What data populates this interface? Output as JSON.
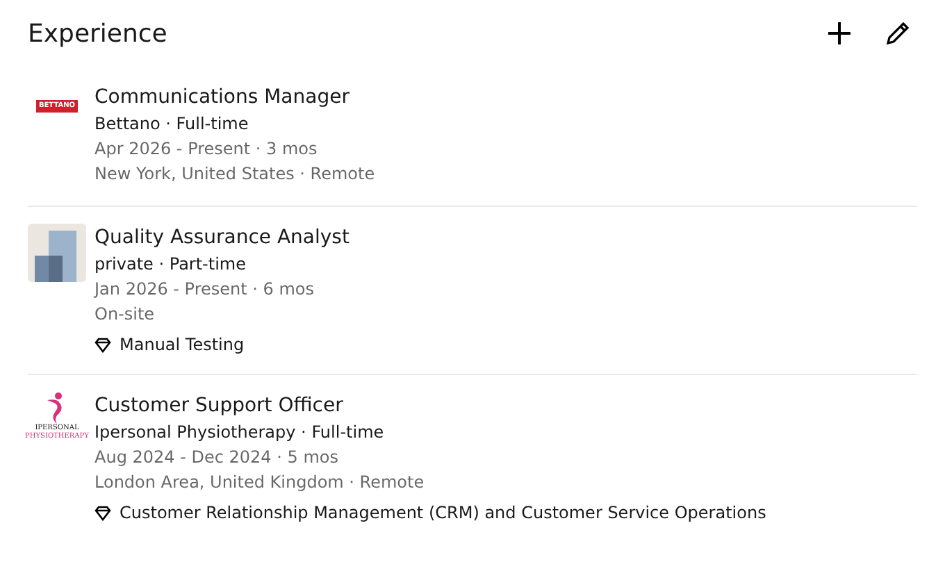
{
  "section": {
    "title": "Experience"
  },
  "experiences": [
    {
      "logo": {
        "kind": "wordmark",
        "text": "BETTANO"
      },
      "title": "Communications Manager",
      "company": "Bettano · Full-time",
      "dates": "Apr 2026 - Present · 3 mos",
      "location": "New York, United States · Remote"
    },
    {
      "logo": {
        "kind": "blocks"
      },
      "title": "Quality Assurance Analyst",
      "company": "private · Part-time",
      "dates": "Jan 2026 - Present · 6 mos",
      "location": "On-site",
      "skill": "Manual Testing"
    },
    {
      "logo": {
        "kind": "figure",
        "text": "IPERSONAL",
        "subtext": "PHYSIOTHERAPY"
      },
      "title": "Customer Support Officer",
      "company": "Ipersonal Physiotherapy · Full-time",
      "dates": "Aug 2024 - Dec 2024 · 5 mos",
      "location": "London Area, United Kingdom · Remote",
      "skill": "Customer Relationship Management (CRM) and Customer Service Operations"
    }
  ]
}
